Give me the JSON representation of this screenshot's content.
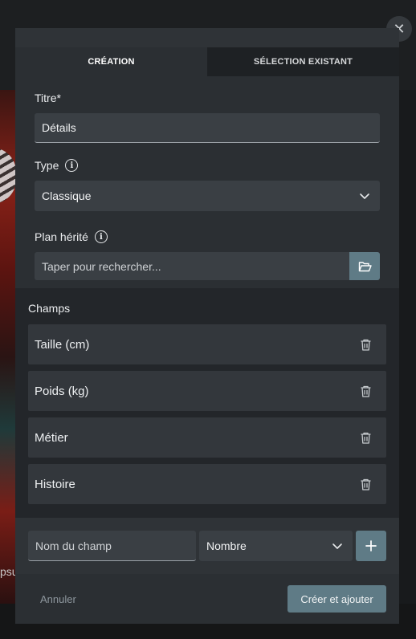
{
  "background": {
    "partial_text": "psu"
  },
  "dialog": {
    "close_icon": "close-icon",
    "tabs": [
      {
        "label": "CRÉATION",
        "active": true
      },
      {
        "label": "SÉLECTION EXISTANT",
        "active": false
      }
    ],
    "form": {
      "title_label": "Titre*",
      "title_value": "Détails",
      "type_label": "Type",
      "type_value": "Classique",
      "inherited_label": "Plan hérité",
      "inherited_placeholder": "Taper pour rechercher..."
    },
    "fields_section": {
      "title": "Champs",
      "items": [
        {
          "label": "Taille (cm)"
        },
        {
          "label": "Poids (kg)"
        },
        {
          "label": "Métier"
        },
        {
          "label": "Histoire"
        }
      ]
    },
    "add_field": {
      "name_placeholder": "Nom du champ",
      "type_value": "Nombre",
      "add_icon": "plus-icon"
    },
    "footer": {
      "cancel_label": "Annuler",
      "submit_label": "Créer et ajouter"
    },
    "colors": {
      "accent": "#5f7b86",
      "dialog_bg": "#2b2f33",
      "input_bg": "#3a3f44"
    }
  }
}
